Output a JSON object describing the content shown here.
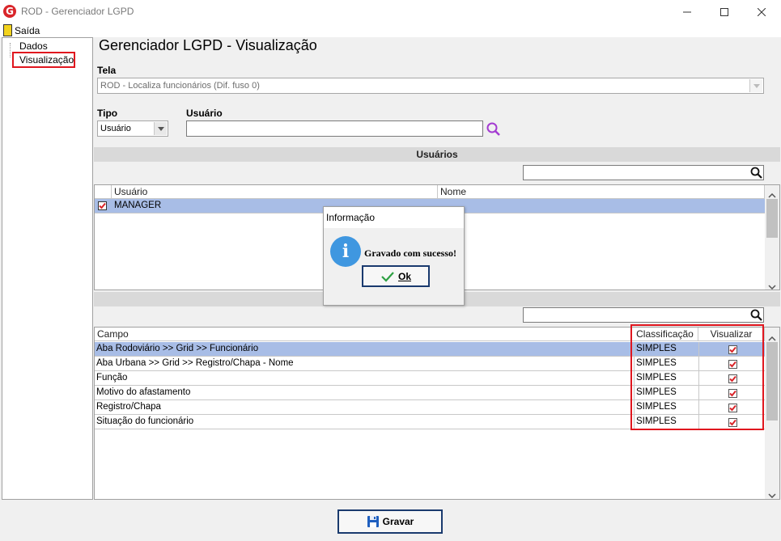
{
  "window": {
    "title": "ROD - Gerenciador LGPD",
    "app_icon_letter": "G"
  },
  "menu": {
    "exit_label": "Saída"
  },
  "tree": {
    "items": [
      {
        "label": "Dados"
      },
      {
        "label": "Visualização"
      }
    ]
  },
  "page": {
    "title": "Gerenciador LGPD - Visualização"
  },
  "form": {
    "tela_label": "Tela",
    "tela_value": "ROD - Localiza funcionários (Dif. fuso 0)",
    "tipo_label": "Tipo",
    "tipo_value": "Usuário",
    "usuario_label": "Usuário",
    "usuario_value": ""
  },
  "users_section": {
    "title": "Usuários",
    "filter_value": "",
    "columns": [
      "Usuário",
      "Nome"
    ],
    "rows": [
      {
        "usuario": "MANAGER",
        "nome": "",
        "checked": true
      }
    ]
  },
  "fields_section": {
    "filter_value": "",
    "columns": [
      "Campo",
      "Classificação",
      "Visualizar"
    ],
    "rows": [
      {
        "campo": "Aba Rodoviário >> Grid >> Funcionário",
        "classificacao": "SIMPLES",
        "visualizar": true
      },
      {
        "campo": "Aba Urbana >> Grid >> Registro/Chapa  - Nome",
        "classificacao": "SIMPLES",
        "visualizar": true
      },
      {
        "campo": "Função",
        "classificacao": "SIMPLES",
        "visualizar": true
      },
      {
        "campo": "Motivo do afastamento",
        "classificacao": "SIMPLES",
        "visualizar": true
      },
      {
        "campo": "Registro/Chapa",
        "classificacao": "SIMPLES",
        "visualizar": true
      },
      {
        "campo": "Situação do funcionário",
        "classificacao": "SIMPLES",
        "visualizar": true
      }
    ]
  },
  "dialog": {
    "title": "Informação",
    "message": "Gravado com sucesso!",
    "ok_label": "Ok",
    "icon_letter": "i"
  },
  "footer": {
    "save_label": "Gravar"
  },
  "colors": {
    "highlight": "#e0161e",
    "selection": "#a8bde6",
    "info": "#3f97e0",
    "check": "#d9252a"
  }
}
